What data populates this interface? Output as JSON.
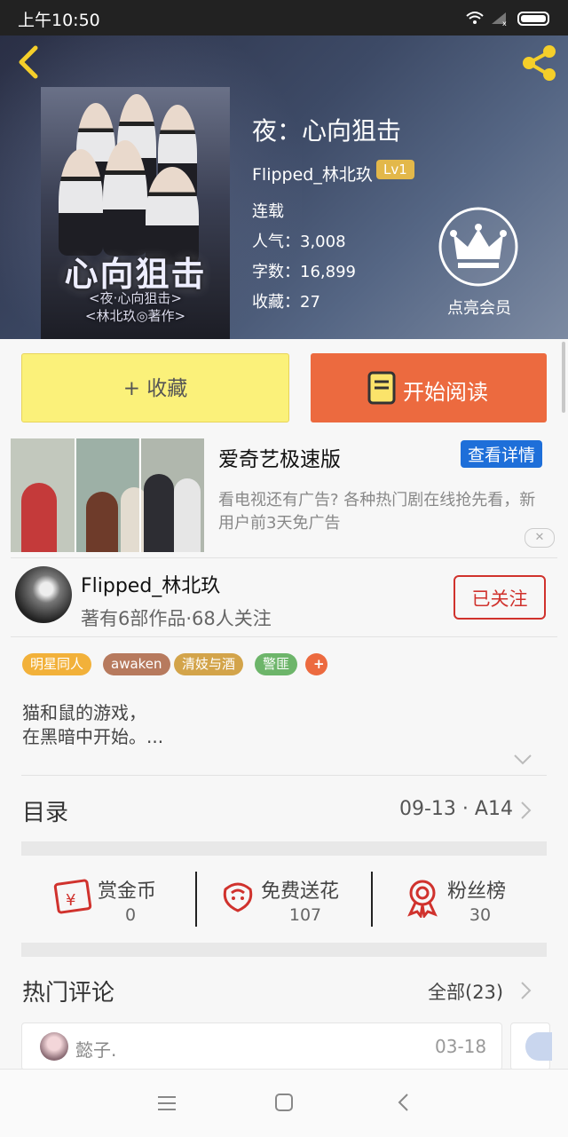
{
  "status_bar": {
    "time": "上午10:50"
  },
  "book": {
    "title": "夜：心向狙击",
    "author": "Flipped_林北玖",
    "level": "Lv1",
    "status": "连载",
    "popularity": "人气：3,008",
    "word_count": "字数：16,899",
    "favorites": "收藏：27",
    "vip_label": "点亮会员",
    "cover_title": "心向狙击",
    "cover_sub1": "<夜·心向狙击>",
    "cover_sub2": "<林北玖◎著作>"
  },
  "actions": {
    "favorite": "+ 收藏",
    "read": "开始阅读"
  },
  "ad": {
    "title": "爱奇艺极速版",
    "button": "查看详情",
    "description": "看电视还有广告? 各种热门剧在线抢先看，新用户前3天免广告"
  },
  "author_row": {
    "name": "Flipped_林北玖",
    "info": "著有6部作品·68人关注",
    "follow": "已关注"
  },
  "tags": [
    "明星同人",
    "awaken",
    "清妓与酒",
    "警匪",
    "+"
  ],
  "tag_colors": [
    "#f2b13a",
    "#b77a5e",
    "#d3a44a",
    "#6db56a",
    "#ec6a3f"
  ],
  "description": {
    "line1": "猫和鼠的游戏，",
    "line2": "在黑暗中开始。..."
  },
  "directory": {
    "label": "目录",
    "latest": "09-13 · A14"
  },
  "stats": [
    {
      "label": "赏金币",
      "value": "0"
    },
    {
      "label": "免费送花",
      "value": "107"
    },
    {
      "label": "粉丝榜",
      "value": "30"
    }
  ],
  "comments": {
    "label": "热门评论",
    "all": "全部(23)",
    "first_user": "懿子.",
    "first_date": "03-18"
  },
  "colors": {
    "accent_red": "#d0322d",
    "read_button": "#ec6a3f",
    "fav_button": "#fbf17a"
  }
}
